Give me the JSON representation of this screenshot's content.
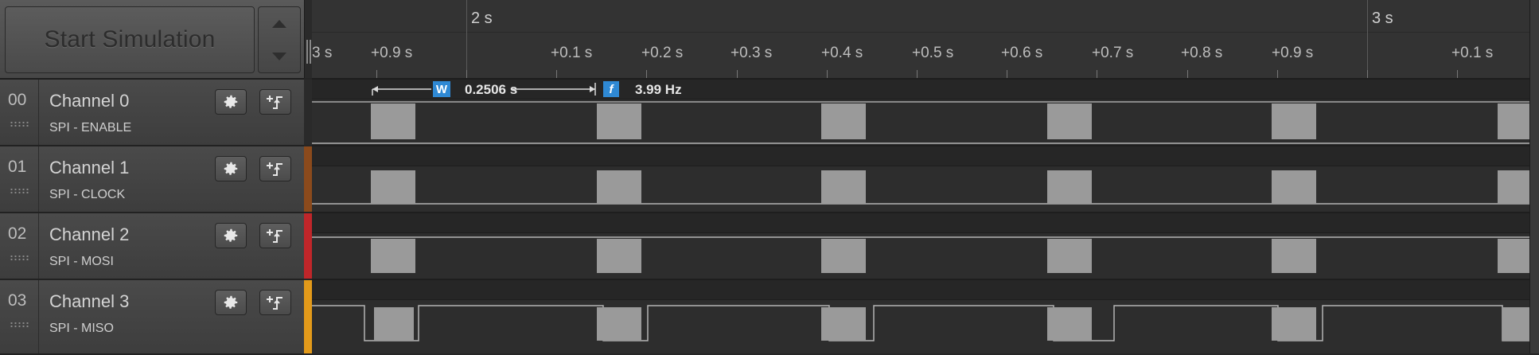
{
  "toolbar": {
    "start_simulation_label": "Start Simulation"
  },
  "channels": [
    {
      "num": "00",
      "name": "Channel 0",
      "analyzer": "SPI - ENABLE",
      "color": "#2a2a2a"
    },
    {
      "num": "01",
      "name": "Channel 1",
      "analyzer": "SPI - CLOCK",
      "color": "#8b4a1c"
    },
    {
      "num": "02",
      "name": "Channel 2",
      "analyzer": "SPI - MOSI",
      "color": "#c0262a"
    },
    {
      "num": "03",
      "name": "Channel 3",
      "analyzer": "SPI - MISO",
      "color": "#e39a1a"
    }
  ],
  "timeline": {
    "major_labels": [
      "2 s",
      "3 s"
    ],
    "minor_labels": [
      "3 s",
      "+0.9 s",
      "+0.1 s",
      "+0.2 s",
      "+0.3 s",
      "+0.4 s",
      "+0.5 s",
      "+0.6 s",
      "+0.7 s",
      "+0.8 s",
      "+0.9 s",
      "+0.1 s"
    ]
  },
  "measurement": {
    "width_icon": "W",
    "width_value": "0.2506 s",
    "freq_icon": "f",
    "freq_value": "3.99 Hz"
  },
  "colors": {
    "signal": "#b4b4b4",
    "pulse_fill": "#9a9a9a",
    "accent": "#2f89d4"
  },
  "icons": {
    "settings": "gear-icon",
    "trigger": "trigger-edge-icon",
    "stepper_up": "chevron-up-icon",
    "stepper_down": "chevron-down-icon"
  }
}
